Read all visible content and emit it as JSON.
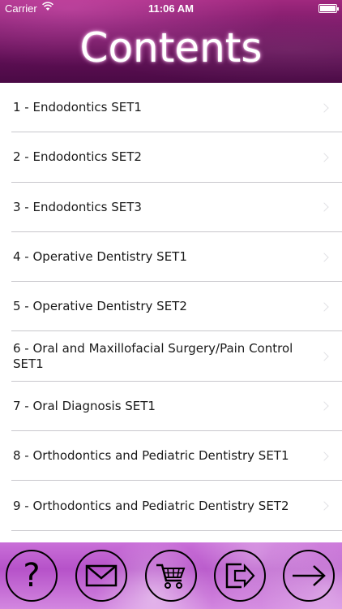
{
  "status_bar": {
    "carrier": "Carrier",
    "time": "11:06 AM"
  },
  "header": {
    "title": "Contents"
  },
  "list": {
    "items": [
      {
        "label": "1 - Endodontics SET1"
      },
      {
        "label": "2 - Endodontics SET2"
      },
      {
        "label": "3 - Endodontics SET3"
      },
      {
        "label": "4 - Operative Dentistry SET1"
      },
      {
        "label": "5 - Operative Dentistry SET2"
      },
      {
        "label": "6 - Oral and Maxillofacial Surgery/Pain Control SET1"
      },
      {
        "label": "7 - Oral Diagnosis SET1"
      },
      {
        "label": "8 - Orthodontics and Pediatric Dentistry SET1"
      },
      {
        "label": "9 - Orthodontics and Pediatric Dentistry SET2"
      }
    ]
  },
  "toolbar": {
    "help_glyph": "?",
    "buttons": [
      "help-icon",
      "mail-icon",
      "cart-icon",
      "exit-icon",
      "arrow-right-icon"
    ]
  },
  "colors": {
    "header_top": "#a0287e",
    "header_bottom": "#4a0a45",
    "toolbar": "#c96fd8",
    "separator": "#c8c7cc"
  }
}
